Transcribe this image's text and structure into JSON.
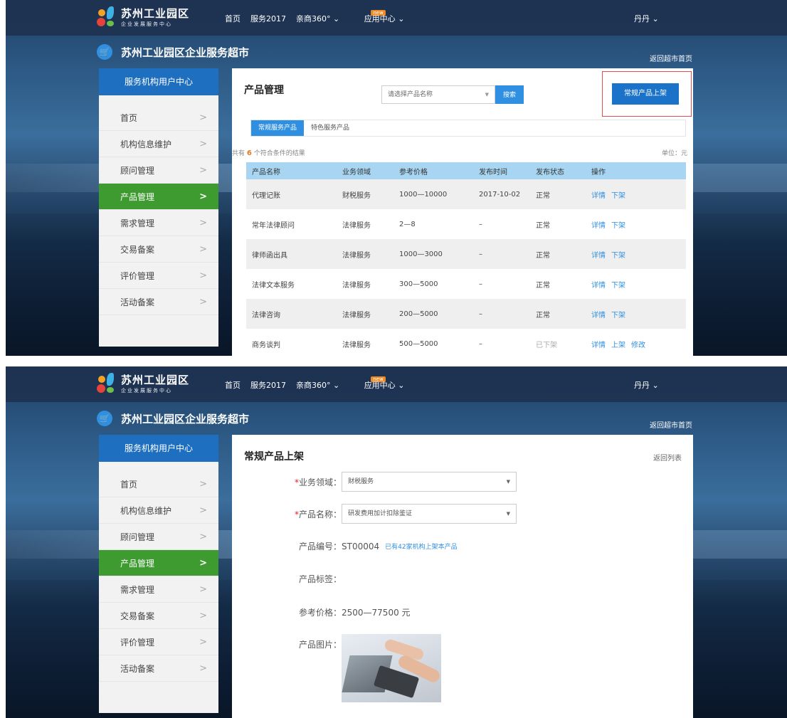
{
  "header": {
    "logo_title": "苏州工业园区",
    "logo_subtitle": "企业发展服务中心",
    "nav": [
      "首页",
      "服务2017",
      "亲商360°",
      "应用中心"
    ],
    "nav_chevron": "⌄",
    "new_badge": "new",
    "user": "丹丹"
  },
  "subheader": {
    "market_title": "苏州工业园区企业服务超市",
    "back_home": "返回超市首页"
  },
  "sidebar": {
    "title": "服务机构用户中心",
    "items": [
      {
        "label": "首页",
        "active": false
      },
      {
        "label": "机构信息维护",
        "active": false
      },
      {
        "label": "顾问管理",
        "active": false
      },
      {
        "label": "产品管理",
        "active": true
      },
      {
        "label": "需求管理",
        "active": false
      },
      {
        "label": "交易备案",
        "active": false
      },
      {
        "label": "评价管理",
        "active": false
      },
      {
        "label": "活动备案",
        "active": false
      }
    ],
    "arrow": ">"
  },
  "product_list": {
    "title": "产品管理",
    "select_placeholder": "请选择产品名称",
    "search_button": "搜索",
    "upload_button": "常规产品上架",
    "tabs": [
      {
        "label": "常规服务产品",
        "active": true
      },
      {
        "label": "特色服务产品",
        "active": false
      }
    ],
    "result_prefix": "共有",
    "result_count": "6",
    "result_suffix": "个符合条件的结果",
    "unit": "单位：元",
    "columns": [
      "产品名称",
      "业务领域",
      "参考价格",
      "发布时间",
      "发布状态",
      "操作"
    ],
    "rows": [
      {
        "name": "代理记账",
        "domain": "财税服务",
        "price": "1000—10000",
        "date": "2017-10-02",
        "status": "正常",
        "ops": [
          "详情",
          "下架"
        ]
      },
      {
        "name": "常年法律顾问",
        "domain": "法律服务",
        "price": "2—8",
        "date": "–",
        "status": "正常",
        "ops": [
          "详情",
          "下架"
        ]
      },
      {
        "name": "律师函出具",
        "domain": "法律服务",
        "price": "1000—3000",
        "date": "–",
        "status": "正常",
        "ops": [
          "详情",
          "下架"
        ]
      },
      {
        "name": "法律文本服务",
        "domain": "法律服务",
        "price": "300—5000",
        "date": "–",
        "status": "正常",
        "ops": [
          "详情",
          "下架"
        ]
      },
      {
        "name": "法律咨询",
        "domain": "法律服务",
        "price": "200—5000",
        "date": "–",
        "status": "正常",
        "ops": [
          "详情",
          "下架"
        ]
      },
      {
        "name": "商务谈判",
        "domain": "法律服务",
        "price": "500—5000",
        "date": "–",
        "status": "已下架",
        "ops": [
          "详情",
          "上架",
          "修改"
        ]
      }
    ]
  },
  "upload_form": {
    "title": "常规产品上架",
    "back_list": "返回列表",
    "required_mark": "*",
    "domain_label": "业务领域：",
    "domain_value": "财税服务",
    "name_label": "产品名称：",
    "name_value": "研发费用加计扣除鉴证",
    "code_label": "产品编号：",
    "code_value": "ST00004",
    "code_note": "已有42家机构上架本产品",
    "tags_label": "产品标签：",
    "price_label": "参考价格：",
    "price_value": "2500—77500 元",
    "image_label": "产品图片："
  }
}
